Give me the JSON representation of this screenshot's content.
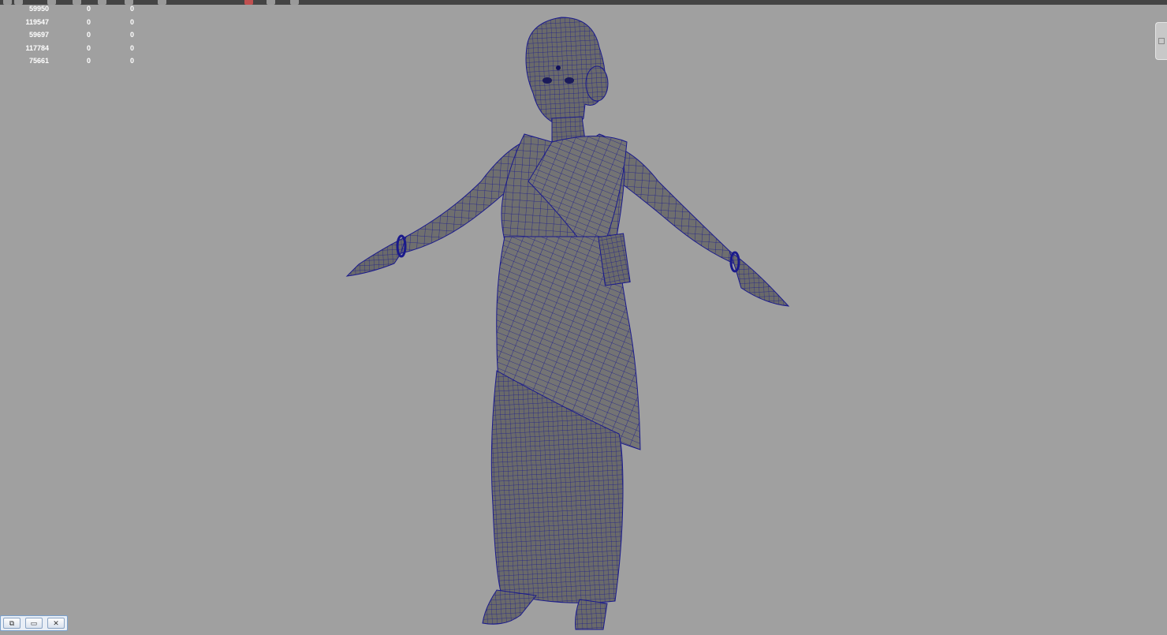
{
  "hud_stats": {
    "rows": [
      [
        "59950",
        "0",
        "0"
      ],
      [
        "119547",
        "0",
        "0"
      ],
      [
        "59697",
        "0",
        "0"
      ],
      [
        "117784",
        "0",
        "0"
      ],
      [
        "75661",
        "0",
        "0"
      ]
    ]
  },
  "icons": {
    "toolbar": [
      "render-icon",
      "snapshot-icon",
      "grid-icon",
      "camera-icon",
      "shading-icon",
      "light-icon",
      "texture-icon",
      "isolate-icon"
    ],
    "viewcube": "viewcube-icon",
    "window_buttons": [
      "restore-icon",
      "minimize-icon",
      "close-icon"
    ]
  },
  "colors": {
    "viewport_bg": "#a0a0a0",
    "mesh_fill": "#6f6f6f",
    "wireframe": "#1a1a8c"
  },
  "window_buttons": {
    "restore": "⧉",
    "minimize": "▭",
    "close": "✕"
  }
}
